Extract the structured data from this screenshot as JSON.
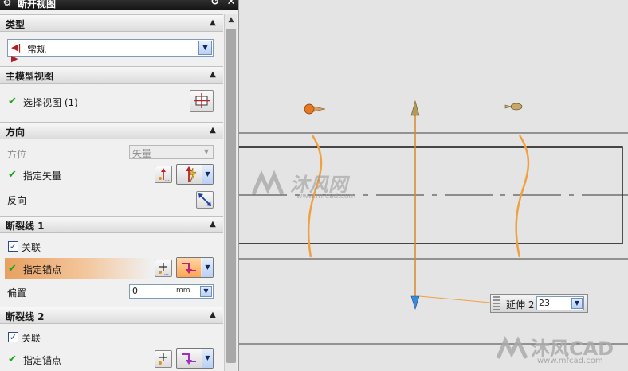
{
  "dialog": {
    "title": "断开视图",
    "reset_glyph": "↺",
    "close_glyph": "✕",
    "settings_icon": "gear-icon"
  },
  "section_type": {
    "label": "类型",
    "dropdown_value": "常规",
    "dropdown_icon": "break-view-icon"
  },
  "section_master": {
    "label": "主模型视图",
    "select_view": "选择视图 (1)"
  },
  "section_direction": {
    "label": "方向",
    "orientation_label": "方位",
    "orientation_value": "矢量",
    "vector_label": "指定矢量",
    "reverse_label": "反向"
  },
  "section_break1": {
    "label": "断裂线 1",
    "associative_label": "关联",
    "associative_checked": true,
    "anchor_label": "指定锚点",
    "offset_label": "偏置",
    "offset_value": "0",
    "offset_unit": "mm"
  },
  "section_break2": {
    "label": "断裂线 2",
    "associative_label": "关联",
    "associative_checked": true,
    "anchor_label": "指定锚点"
  },
  "canvas": {
    "extension_label": "延伸 2",
    "extension_value": "23",
    "watermark_main": "沐风网",
    "watermark_url": "www.mfcad.com",
    "watermark_corner": "沐风CAD",
    "watermark_corner_url": "www.mfcad.com",
    "accent_color": "#f0a040"
  }
}
